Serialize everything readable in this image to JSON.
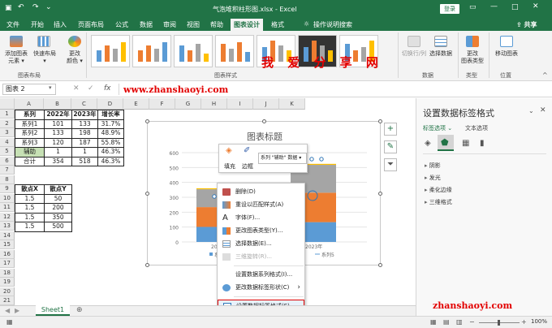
{
  "window": {
    "title": "气泡堆积柱形图.xlsx  -  Excel",
    "login": "登录"
  },
  "tabs": [
    "文件",
    "开始",
    "插入",
    "页面布局",
    "公式",
    "数据",
    "审阅",
    "视图",
    "帮助",
    "图表设计",
    "格式"
  ],
  "active_tab": "图表设计",
  "tell_me": "操作说明搜索",
  "share": "共享",
  "ribbon": {
    "add_element": "添加图表\n元素 ▾",
    "quick_layout": "快速布局\n▾",
    "change_color": "更改\n颜色 ▾",
    "group_layout": "图表布局",
    "group_styles": "图表样式",
    "switch_row_col": "切换行/列",
    "select_data": "选择数据",
    "group_data": "数据",
    "change_type": "更改\n图表类型",
    "group_type": "类型",
    "move_chart": "移动图表",
    "group_location": "位置"
  },
  "watermark_top": "我 爱 分 享 网",
  "watermark_url": "www.zhanshaoyi.com",
  "watermark_bottom": "zhanshaoyi.com",
  "namebox": "图表 2",
  "columns": [
    "A",
    "B",
    "C",
    "D",
    "E",
    "F",
    "G",
    "H",
    "I",
    "J",
    "K"
  ],
  "rows": [
    "1",
    "2",
    "3",
    "4",
    "5",
    "6",
    "7",
    "8",
    "9",
    "10",
    "11",
    "12",
    "13",
    "14",
    "15",
    "16",
    "17",
    "18",
    "19",
    "20",
    "21"
  ],
  "table1": {
    "header": [
      "系列",
      "2022年",
      "2023年",
      "增长率"
    ],
    "rows": [
      [
        "系列1",
        "101",
        "133",
        "31.7%"
      ],
      [
        "系列2",
        "133",
        "198",
        "48.9%"
      ],
      [
        "系列3",
        "120",
        "187",
        "55.8%"
      ],
      [
        "辅助",
        "1",
        "1",
        "46.3%"
      ],
      [
        "合计",
        "354",
        "518",
        "46.3%"
      ]
    ]
  },
  "table2": {
    "header": [
      "散点X",
      "散点Y"
    ],
    "rows": [
      [
        "1.5",
        "50"
      ],
      [
        "1.5",
        "200"
      ],
      [
        "1.5",
        "350"
      ],
      [
        "1.5",
        "500"
      ]
    ]
  },
  "chart": {
    "title": "图表标题",
    "y_ticks": [
      "600",
      "500",
      "400",
      "300",
      "200",
      "100",
      "0"
    ],
    "x_labels": [
      "202",
      "2023年"
    ],
    "legend_left": "系",
    "legend_right": "系列5",
    "colors": {
      "s1": "#5b9bd5",
      "s2": "#ed7d31",
      "s3": "#a5a5a5",
      "aux": "#ffc000"
    }
  },
  "chart_data": {
    "type": "bar",
    "categories": [
      "2022年",
      "2023年"
    ],
    "series": [
      {
        "name": "系列1",
        "values": [
          101,
          133
        ]
      },
      {
        "name": "系列2",
        "values": [
          133,
          198
        ]
      },
      {
        "name": "系列3",
        "values": [
          120,
          187
        ]
      },
      {
        "name": "辅助",
        "values": [
          1,
          1
        ]
      }
    ],
    "title": "图表标题",
    "ylim": [
      0,
      600
    ]
  },
  "mini_toolbar": {
    "fill": "填充",
    "outline": "边框",
    "series_select": "系列 \"辅助\" 数据 ▾"
  },
  "context_menu": [
    {
      "label": "删除(D)",
      "icon": "delete-icon",
      "disabled": false
    },
    {
      "label": "重设以匹配样式(A)",
      "icon": "reset-icon",
      "disabled": false
    },
    {
      "label": "字体(F)...",
      "icon": "font-icon",
      "disabled": false
    },
    {
      "label": "更改图表类型(Y)...",
      "icon": "chart-type-icon",
      "disabled": false
    },
    {
      "label": "选择数据(E)...",
      "icon": "select-data-icon",
      "disabled": false
    },
    {
      "label": "三维旋转(R)...",
      "icon": "rotate-3d-icon",
      "disabled": true
    },
    {
      "label": "设置数据系列格式(I)...",
      "icon": "",
      "disabled": false
    },
    {
      "label": "更改数据标签形状(C)",
      "icon": "label-shape-icon",
      "disabled": false,
      "submenu": true
    },
    {
      "label": "设置数据标签格式(E)...",
      "icon": "format-label-icon",
      "disabled": false,
      "highlight": true
    }
  ],
  "pane": {
    "title": "设置数据标签格式",
    "tab1": "标签选项",
    "tab2": "文本选项",
    "sections": [
      "阴影",
      "发光",
      "柔化边缘",
      "三维格式"
    ]
  },
  "sheet_tab": "Sheet1",
  "zoom": "100%"
}
